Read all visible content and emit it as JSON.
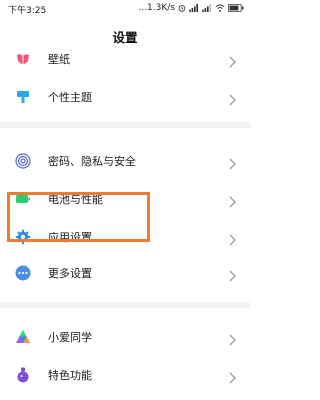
{
  "status_bar": {
    "time": "下午3:25",
    "network_speed": "...1.3K/s",
    "battery_level": 0.85
  },
  "header": {
    "title": "设置"
  },
  "settings": {
    "items": [
      {
        "label": "壁纸",
        "icon": "wallpaper-icon"
      },
      {
        "label": "个性主题",
        "icon": "theme-brush-icon"
      },
      {
        "label": "密码、隐私与安全",
        "icon": "fingerprint-icon"
      },
      {
        "label": "电池与性能",
        "icon": "battery-icon"
      },
      {
        "label": "应用设置",
        "icon": "gear-icon"
      },
      {
        "label": "更多设置",
        "icon": "more-dots-icon"
      },
      {
        "label": "小爱同学",
        "icon": "xiaoai-icon"
      },
      {
        "label": "特色功能",
        "icon": "feature-flask-icon"
      }
    ]
  },
  "colors": {
    "highlight": "#ef7d2f",
    "wallpaper": "#e85a7a",
    "theme": "#2fa6e6",
    "security": "#5b6bd6",
    "battery": "#2ecc71",
    "gear": "#2a8be6",
    "more": "#4a8de8",
    "feature": "#7b4fd6"
  }
}
